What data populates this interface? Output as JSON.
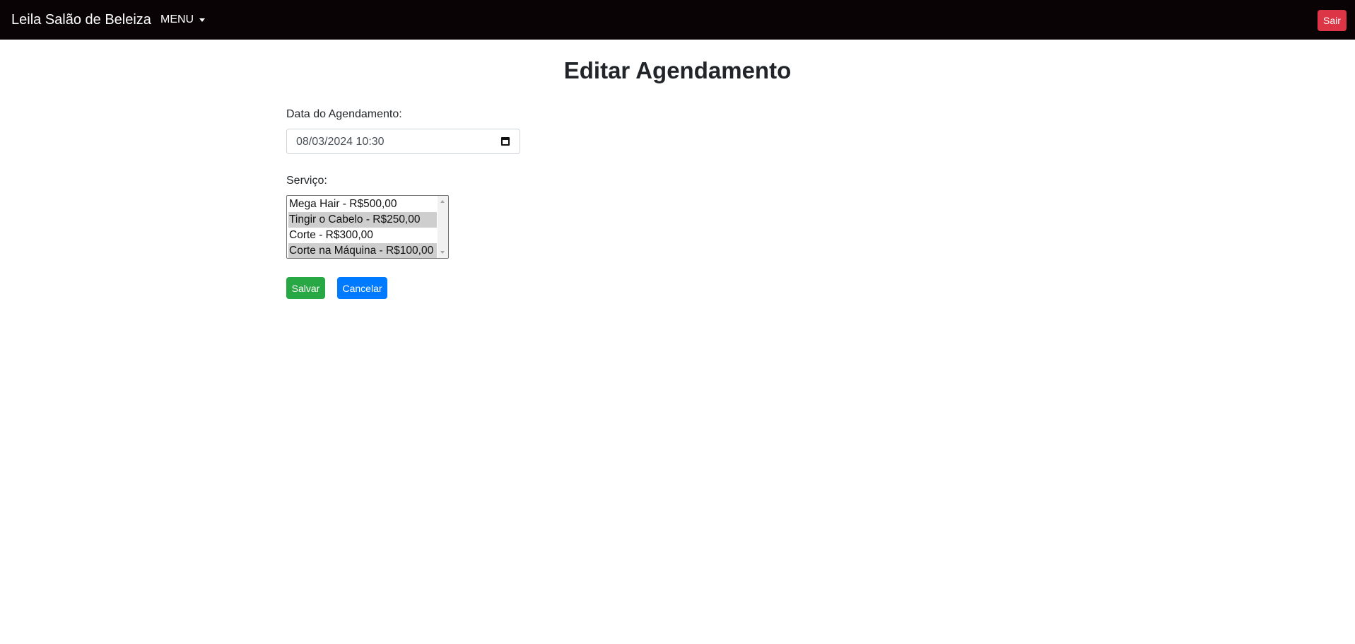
{
  "navbar": {
    "brand": "Leila Salão de Beleiza",
    "menu_label": "MENU",
    "logout_label": "Sair"
  },
  "page": {
    "title": "Editar Agendamento"
  },
  "form": {
    "date_label": "Data do Agendamento:",
    "date_value": "08/03/2024 10:30",
    "service_label": "Serviço:",
    "services": [
      {
        "label": "Mega Hair - R$500,00",
        "selected": false
      },
      {
        "label": "Tingir o Cabelo - R$250,00",
        "selected": true
      },
      {
        "label": "Corte - R$300,00",
        "selected": false
      },
      {
        "label": "Corte na Máquina - R$100,00",
        "selected": true
      }
    ],
    "save_label": "Salvar",
    "cancel_label": "Cancelar"
  },
  "colors": {
    "navbar_bg": "#0a0306",
    "logout_btn": "#dc3545",
    "save_btn": "#28a745",
    "cancel_btn": "#007bff",
    "selected_option": "#cecece"
  },
  "icons": {
    "menu_caret": "chevron-down-icon",
    "date_picker": "calendar-icon"
  }
}
